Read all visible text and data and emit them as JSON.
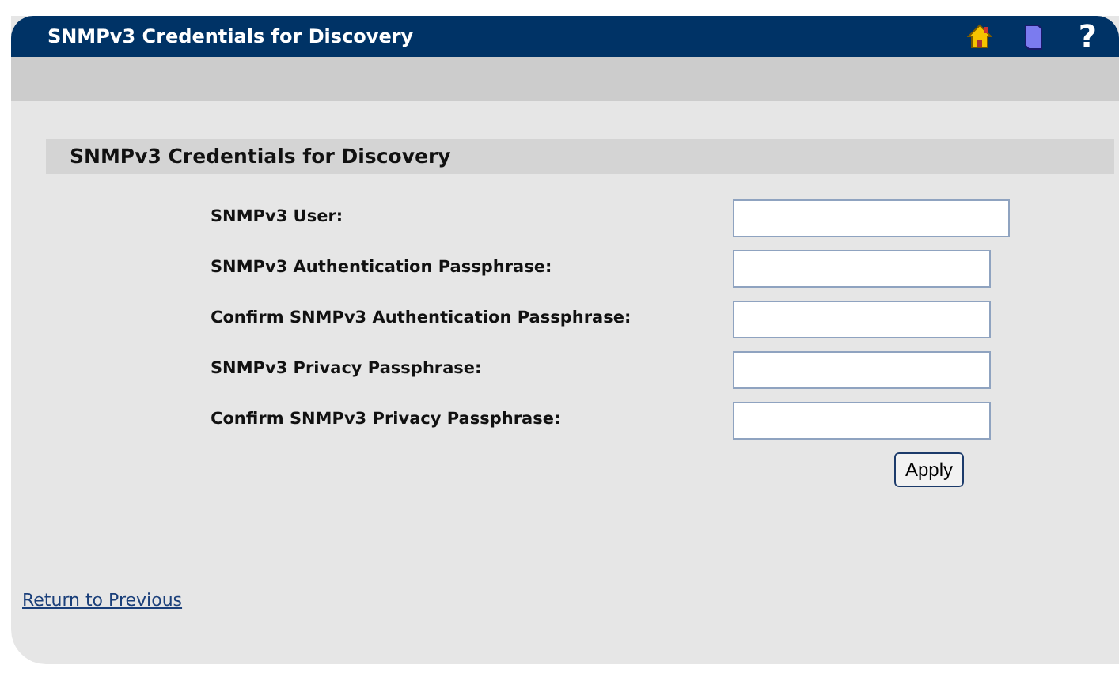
{
  "window": {
    "title": "SNMPv3 Credentials for Discovery",
    "help": "?"
  },
  "section": {
    "title": "SNMPv3 Credentials for Discovery"
  },
  "fields": [
    {
      "label": "SNMPv3 User:",
      "kind": "text"
    },
    {
      "label": "SNMPv3 Authentication Passphrase:",
      "kind": "password"
    },
    {
      "label": "Confirm SNMPv3 Authentication Passphrase:",
      "kind": "password"
    },
    {
      "label": "SNMPv3 Privacy Passphrase:",
      "kind": "password"
    },
    {
      "label": "Confirm SNMPv3 Privacy Passphrase:",
      "kind": "password"
    }
  ],
  "apply_button": "Apply",
  "return_link": "Return to Previous"
}
